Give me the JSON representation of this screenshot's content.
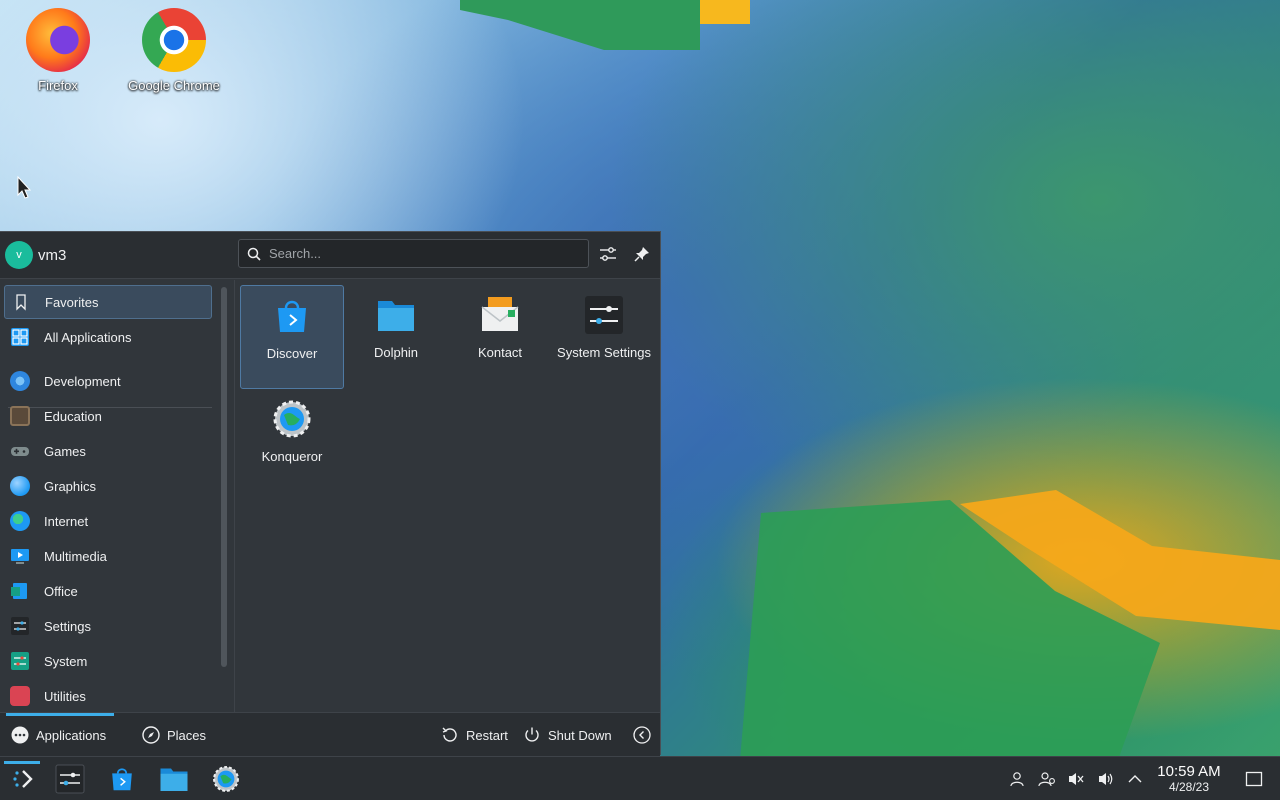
{
  "desktop": {
    "icons": [
      {
        "label": "Firefox",
        "icon": "firefox-icon"
      },
      {
        "label": "Google Chrome",
        "icon": "chrome-icon"
      }
    ]
  },
  "launcher": {
    "user": {
      "avatar_initial": "v",
      "name": "vm3"
    },
    "search": {
      "placeholder": "Search..."
    },
    "sidebar": {
      "items": [
        {
          "label": "Favorites",
          "icon": "bookmark-icon",
          "selected": true
        },
        {
          "label": "All Applications",
          "icon": "grid-icon"
        },
        {
          "label": "Development",
          "icon": "development-icon"
        },
        {
          "label": "Education",
          "icon": "education-icon"
        },
        {
          "label": "Games",
          "icon": "gamepad-icon"
        },
        {
          "label": "Graphics",
          "icon": "graphics-icon"
        },
        {
          "label": "Internet",
          "icon": "globe-icon"
        },
        {
          "label": "Multimedia",
          "icon": "multimedia-icon"
        },
        {
          "label": "Office",
          "icon": "office-icon"
        },
        {
          "label": "Settings",
          "icon": "settings-icon"
        },
        {
          "label": "System",
          "icon": "system-icon"
        },
        {
          "label": "Utilities",
          "icon": "utilities-icon"
        }
      ]
    },
    "favorites": [
      {
        "label": "Discover",
        "icon": "discover-icon",
        "selected": true
      },
      {
        "label": "Dolphin",
        "icon": "folder-icon"
      },
      {
        "label": "Kontact",
        "icon": "kontact-icon"
      },
      {
        "label": "System Settings",
        "icon": "system-settings-icon"
      },
      {
        "label": "Konqueror",
        "icon": "konqueror-icon"
      }
    ],
    "footer": {
      "applications": "Applications",
      "places": "Places",
      "restart": "Restart",
      "shutdown": "Shut Down"
    }
  },
  "taskbar": {
    "clock": {
      "time": "10:59 AM",
      "date": "4/28/23"
    }
  },
  "colors": {
    "accent": "#3daee9",
    "panel": "#31363b",
    "panel_dark": "#2a2e32"
  }
}
